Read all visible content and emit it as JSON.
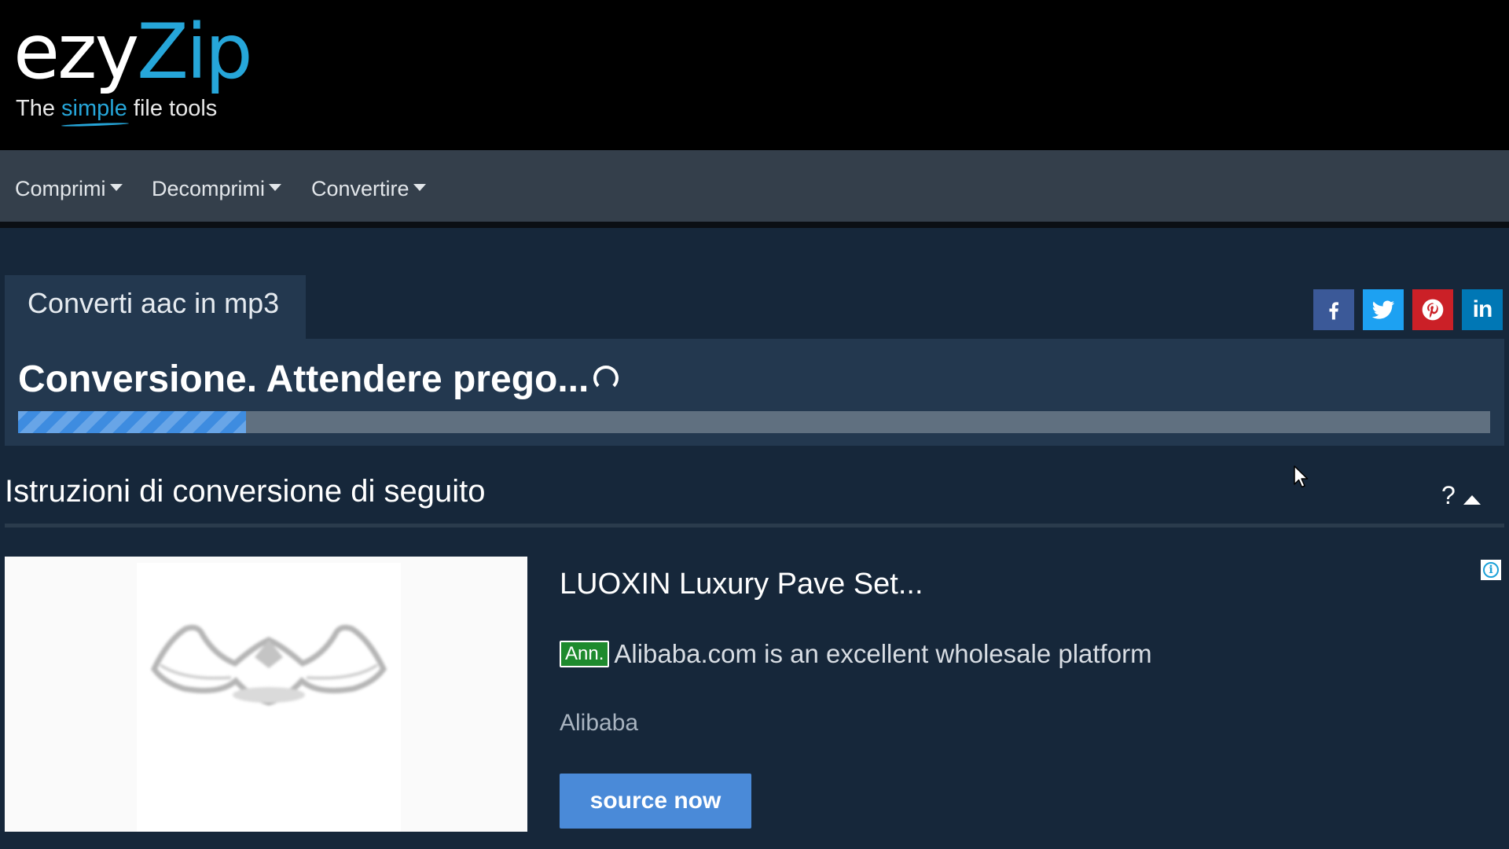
{
  "header": {
    "logo_part1": "ezy",
    "logo_part2": "Zip",
    "tagline_pre": "The ",
    "tagline_simple": "simple",
    "tagline_post": " file tools"
  },
  "nav": {
    "items": [
      {
        "label": "Comprimi"
      },
      {
        "label": "Decomprimi"
      },
      {
        "label": "Convertire"
      }
    ]
  },
  "tool": {
    "tab_label": "Converti aac in mp3",
    "status": "Conversione. Attendere prego...",
    "progress_fraction": 0.155
  },
  "share": {
    "colors": {
      "facebook": "#3b5998",
      "twitter": "#1da1f2",
      "pinterest": "#cb2027",
      "linkedin": "#0077b5"
    },
    "linkedin_label": "in"
  },
  "instructions": {
    "heading": "Istruzioni di conversione di seguito",
    "help": "?"
  },
  "ad": {
    "title": "LUOXIN Luxury Pave Set...",
    "badge": "Ann.",
    "description": "Alibaba.com is an excellent wholesale platform",
    "source": "Alibaba",
    "cta": "source now",
    "info_icon": "i"
  },
  "theme": {
    "accent": "#26a6d9",
    "background": "#16273a",
    "panel": "#23384f",
    "progress": "#3e8ce0"
  }
}
